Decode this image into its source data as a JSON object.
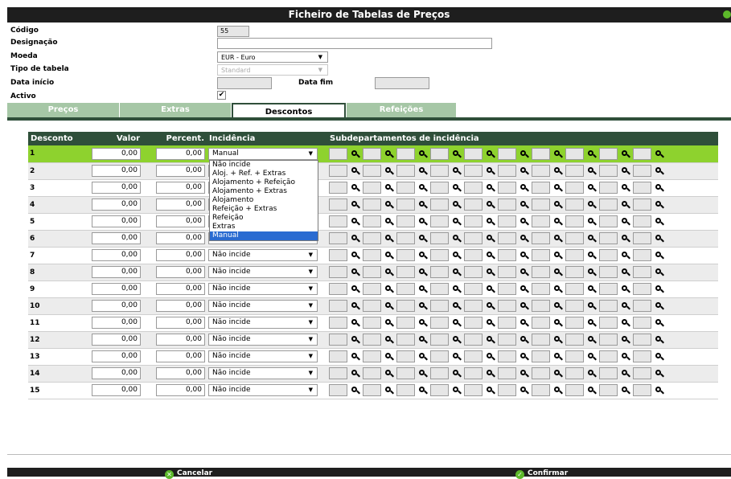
{
  "window": {
    "title": "Ficheiro de Tabelas de Preços"
  },
  "form": {
    "codigo_label": "Código",
    "codigo_value": "55",
    "designacao_label": "Designação",
    "designacao_value": "",
    "moeda_label": "Moeda",
    "moeda_value": "EUR - Euro",
    "tipo_label": "Tipo de tabela",
    "tipo_value": "Standard",
    "data_inicio_label": "Data início",
    "data_inicio_value": "",
    "data_fim_label": "Data fim",
    "data_fim_value": "",
    "activo_label": "Activo",
    "activo_checked": true,
    "check_glyph": "✔"
  },
  "tabs": [
    {
      "label": "Preços",
      "active": false
    },
    {
      "label": "Extras",
      "active": false
    },
    {
      "label": "Descontos",
      "active": true
    },
    {
      "label": "Refeições",
      "active": false
    }
  ],
  "table": {
    "headers": {
      "desconto": "Desconto",
      "valor": "Valor",
      "percent": "Percent.",
      "incidencia": "Incidência",
      "subdep": "Subdepartamentos de incidência"
    },
    "rows": [
      {
        "num": "1",
        "valor": "0,00",
        "percent": "0,00",
        "incidencia": "Manual"
      },
      {
        "num": "2",
        "valor": "0,00",
        "percent": "0,00",
        "incidencia": "Não incide"
      },
      {
        "num": "3",
        "valor": "0,00",
        "percent": "0,00",
        "incidencia": "Não incide"
      },
      {
        "num": "4",
        "valor": "0,00",
        "percent": "0,00",
        "incidencia": "Não incide"
      },
      {
        "num": "5",
        "valor": "0,00",
        "percent": "0,00",
        "incidencia": "Não incide"
      },
      {
        "num": "6",
        "valor": "0,00",
        "percent": "0,00",
        "incidencia": "Não incide"
      },
      {
        "num": "7",
        "valor": "0,00",
        "percent": "0,00",
        "incidencia": "Não incide"
      },
      {
        "num": "8",
        "valor": "0,00",
        "percent": "0,00",
        "incidencia": "Não incide"
      },
      {
        "num": "9",
        "valor": "0,00",
        "percent": "0,00",
        "incidencia": "Não incide"
      },
      {
        "num": "10",
        "valor": "0,00",
        "percent": "0,00",
        "incidencia": "Não incide"
      },
      {
        "num": "11",
        "valor": "0,00",
        "percent": "0,00",
        "incidencia": "Não incide"
      },
      {
        "num": "12",
        "valor": "0,00",
        "percent": "0,00",
        "incidencia": "Não incide"
      },
      {
        "num": "13",
        "valor": "0,00",
        "percent": "0,00",
        "incidencia": "Não incide"
      },
      {
        "num": "14",
        "valor": "0,00",
        "percent": "0,00",
        "incidencia": "Não incide"
      },
      {
        "num": "15",
        "valor": "0,00",
        "percent": "0,00",
        "incidencia": "Não incide"
      }
    ],
    "selected_row": 1,
    "subdep_slots_per_row": 10
  },
  "dropdown": {
    "options": [
      "Não incide",
      "Aloj. + Ref. + Extras",
      "Alojamento + Refeição",
      "Alojamento + Extras",
      "Alojamento",
      "Refeição + Extras",
      "Refeição",
      "Extras",
      "Manual"
    ],
    "highlighted": "Manual"
  },
  "footer": {
    "cancel_label": "Cancelar",
    "confirm_label": "Confirmar"
  },
  "colors": {
    "header_green": "#2f4f3a",
    "selected_row_green": "#8ed22e",
    "tab_inactive": "#a6c7a6",
    "highlight_blue": "#2a6bd1"
  }
}
